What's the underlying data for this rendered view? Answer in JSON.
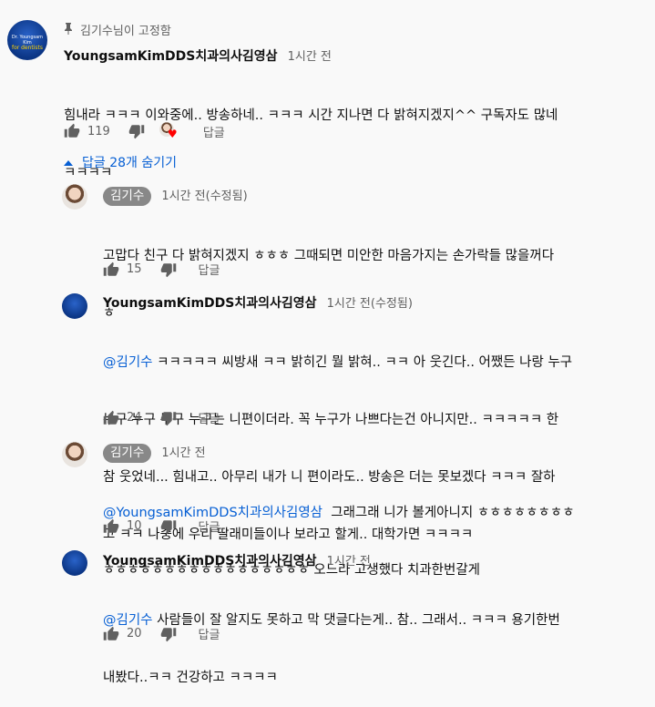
{
  "thread": {
    "pinned_text": "김기수님이 고정함",
    "author": "YoungsamKimDDS치과의사김영삼",
    "time": "1시간 전",
    "text_line1": "힘내라 ㅋㅋㅋ 이와중에.. 방송하네.. ㅋㅋㅋ 시간 지나면 다 밝혀지겠지^^ 구독자도 많네",
    "text_line2": "ㅋㅋㅋㅋ",
    "likes": "119",
    "reply_label": "답글",
    "avatar_text1": "Dr. Youngsam Kim",
    "avatar_text2": "for dentists",
    "hide_replies": "답글 28개 숨기기"
  },
  "replies": [
    {
      "author": "김기수",
      "time": "1시간 전(수정됨)",
      "text_line1": "고맙다 친구 다 밝혀지겠지 ㅎㅎㅎ 그때되면 미안한 마음가지는 손가락들 많을꺼다",
      "text_line2": "ㅎ",
      "likes": "15",
      "reply_label": "답글"
    },
    {
      "author": "YoungsamKimDDS치과의사김영삼",
      "time": "1시간 전(수정됨)",
      "mention": "@김기수",
      "text_line1": " ㅋㅋㅋㅋㅋ 씨방새 ㅋㅋ 밝히긴 뭘 밝혀.. ㅋㅋ 아 웃긴다.. 어쨌든 나랑 누구",
      "text_line2": "누구 누구 누구 누구는 니편이더라. 꼭 누구가 나쁘다는건 아니지만.. ㅋㅋㅋㅋㅋ 한",
      "text_line3": "참 웃었네... 힘내고.. 아무리 내가 니 편이라도.. 방송은 더는 못보겠다 ㅋㅋㅋ 잘하",
      "text_line4": "고 ㅋㅋ 나중에 우리 딸래미들이나 보라고 할게.. 대학가면 ㅋㅋㅋㅋ",
      "likes": "24",
      "reply_label": "답글"
    },
    {
      "author": "김기수",
      "time": "1시간 전",
      "mention": "@YoungsamKimDDS치과의사김영삼",
      "text_line1": "  그래그래 니가 볼게아니지 ㅎㅎㅎㅎㅎㅎㅎㅎ",
      "text_line2": "ㅎㅎㅎㅎㅎㅎㅎㅎㅎㅎㅎㅎㅎㅎㅎㅎㅎ 오느라 고생했다 치과한번갈게",
      "likes": "10",
      "reply_label": "답글"
    },
    {
      "author": "YoungsamKimDDS치과의사김영삼",
      "time": "1시간 전",
      "mention": "@김기수",
      "text_line1": " 사람들이 잘 알지도 못하고 막 댓글다는게.. 참.. 그래서.. ㅋㅋㅋ 용기한번",
      "text_line2": "내봤다..ㅋㅋ 건강하고 ㅋㅋㅋㅋ",
      "likes": "20",
      "reply_label": "답글"
    }
  ],
  "colors": {
    "link": "#065fd4",
    "badge": "#888888",
    "secondary": "#606060",
    "heart": "#ff0000"
  }
}
